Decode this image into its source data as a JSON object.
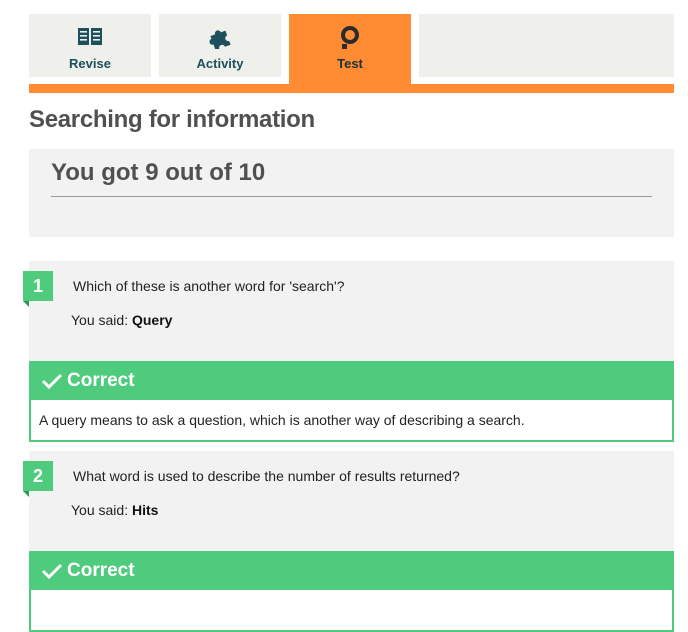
{
  "tabs": [
    {
      "label": "Revise",
      "icon": "book-icon"
    },
    {
      "label": "Activity",
      "icon": "puzzle-piece-icon"
    },
    {
      "label": "Test",
      "icon": "magnifier-icon"
    }
  ],
  "colors": {
    "accent": "#ff8c33",
    "correct": "#4fcb7d",
    "panel": "#f2f2f2",
    "tab_text": "#1d4f5c"
  },
  "page": {
    "title": "Searching for information",
    "score_text": "You got 9 out of 10"
  },
  "questions": [
    {
      "number": "1",
      "text": "Which of these is another word for 'search'?",
      "answer_prefix": "You said:",
      "answer": "Query",
      "result": "Correct",
      "explanation": "A query means to ask a question, which is another way of describing a search."
    },
    {
      "number": "2",
      "text": "What word is used to describe the number of results returned?",
      "answer_prefix": "You said:",
      "answer": "Hits",
      "result": "Correct",
      "explanation": ""
    }
  ]
}
